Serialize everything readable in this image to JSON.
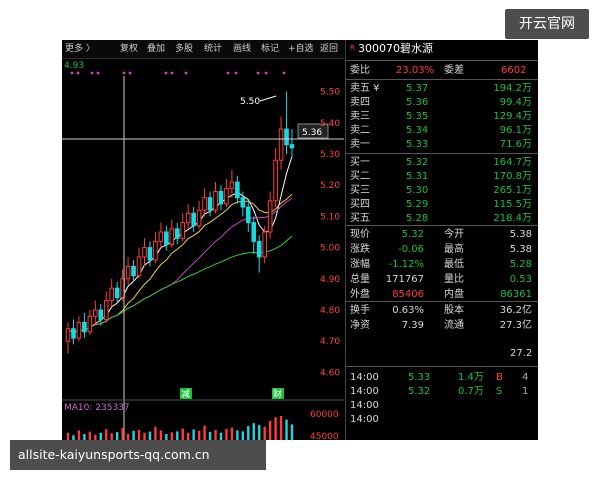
{
  "badge": "开云官网",
  "watermark": "allsite-kaiyunsports-qq.com.cn",
  "toolbar": {
    "more": "更多 〉",
    "fuquan": "复权",
    "diejia": "叠加",
    "duogu": "多股",
    "tongji": "统计",
    "huaxian": "画线",
    "biaoji": "标记",
    "zixuan": "+自选",
    "fanhui": "返回"
  },
  "chart": {
    "left_value": "4.93",
    "price_ticks": [
      "5.50",
      "5.40",
      "5.30",
      "5.20",
      "5.10",
      "5.00",
      "4.90",
      "4.80",
      "4.70",
      "4.60"
    ],
    "peak_label": "5.50",
    "cursor_price": "5.36",
    "marker_jian": "减",
    "marker_cai": "财",
    "ma_label": "MA10: 235337",
    "vol_ticks": [
      "60000",
      "45000"
    ]
  },
  "chart_data": {
    "type": "candlestick",
    "price_axis": {
      "min": 4.55,
      "max": 5.55
    },
    "candles": [
      [
        4.7,
        4.74,
        4.66,
        4.76
      ],
      [
        4.74,
        4.71,
        4.69,
        4.77
      ],
      [
        4.71,
        4.76,
        4.7,
        4.78
      ],
      [
        4.76,
        4.73,
        4.71,
        4.79
      ],
      [
        4.73,
        4.78,
        4.72,
        4.8
      ],
      [
        4.78,
        4.8,
        4.75,
        4.83
      ],
      [
        4.8,
        4.77,
        4.75,
        4.82
      ],
      [
        4.77,
        4.83,
        4.76,
        4.86
      ],
      [
        4.83,
        4.87,
        4.81,
        4.9
      ],
      [
        4.87,
        4.84,
        4.82,
        4.89
      ],
      [
        4.84,
        4.9,
        4.83,
        4.93
      ],
      [
        4.9,
        4.94,
        4.88,
        4.97
      ],
      [
        4.94,
        4.91,
        4.89,
        4.96
      ],
      [
        4.91,
        4.97,
        4.9,
        5.0
      ],
      [
        4.97,
        5.0,
        4.94,
        5.03
      ],
      [
        5.0,
        4.96,
        4.94,
        5.02
      ],
      [
        4.96,
        5.02,
        4.95,
        5.05
      ],
      [
        5.02,
        5.05,
        5.0,
        5.08
      ],
      [
        5.05,
        5.01,
        4.99,
        5.07
      ],
      [
        5.01,
        5.06,
        5.0,
        5.09
      ],
      [
        5.06,
        5.03,
        5.01,
        5.08
      ],
      [
        5.03,
        5.08,
        5.02,
        5.11
      ],
      [
        5.08,
        5.11,
        5.06,
        5.14
      ],
      [
        5.11,
        5.07,
        5.05,
        5.13
      ],
      [
        5.07,
        5.12,
        5.06,
        5.15
      ],
      [
        5.12,
        5.16,
        5.1,
        5.19
      ],
      [
        5.16,
        5.12,
        5.1,
        5.18
      ],
      [
        5.12,
        5.18,
        5.11,
        5.21
      ],
      [
        5.18,
        5.14,
        5.12,
        5.2
      ],
      [
        5.14,
        5.19,
        5.13,
        5.22
      ],
      [
        5.19,
        5.21,
        5.16,
        5.25
      ],
      [
        5.21,
        5.16,
        5.14,
        5.23
      ],
      [
        5.16,
        5.13,
        5.1,
        5.18
      ],
      [
        5.13,
        5.08,
        5.05,
        5.15
      ],
      [
        5.08,
        5.02,
        4.98,
        5.1
      ],
      [
        5.02,
        4.97,
        4.92,
        5.04
      ],
      [
        4.97,
        5.05,
        4.95,
        5.07
      ],
      [
        5.05,
        5.15,
        5.03,
        5.18
      ],
      [
        5.15,
        5.28,
        5.13,
        5.32
      ],
      [
        5.28,
        5.38,
        5.25,
        5.42
      ],
      [
        5.38,
        5.33,
        5.3,
        5.5
      ],
      [
        5.33,
        5.32,
        5.29,
        5.38
      ]
    ],
    "volumes": [
      0.3,
      0.2,
      0.4,
      0.25,
      0.35,
      0.22,
      0.3,
      0.45,
      0.28,
      0.33,
      0.5,
      0.26,
      0.38,
      0.42,
      0.3,
      0.35,
      0.55,
      0.4,
      0.25,
      0.32,
      0.36,
      0.48,
      0.3,
      0.44,
      0.38,
      0.6,
      0.34,
      0.42,
      0.3,
      0.46,
      0.52,
      0.4,
      0.36,
      0.58,
      0.7,
      0.62,
      0.55,
      0.8,
      0.95,
      1.0,
      0.85,
      0.65
    ]
  },
  "quote": {
    "code": "300070",
    "name": "碧水源",
    "weibi_label": "委比",
    "weibi": "23.03%",
    "weicha_label": "委差",
    "weicha": "6602",
    "asks": [
      {
        "label": "卖五 ¥",
        "price": "5.37",
        "vol": "194.2万"
      },
      {
        "label": "卖四",
        "price": "5.36",
        "vol": "99.4万"
      },
      {
        "label": "卖三",
        "price": "5.35",
        "vol": "129.4万"
      },
      {
        "label": "卖二",
        "price": "5.34",
        "vol": "96.1万"
      },
      {
        "label": "卖一",
        "price": "5.33",
        "vol": "71.6万"
      }
    ],
    "bids": [
      {
        "label": "买一",
        "price": "5.32",
        "vol": "164.7万"
      },
      {
        "label": "买二",
        "price": "5.31",
        "vol": "170.8万"
      },
      {
        "label": "买三",
        "price": "5.30",
        "vol": "265.1万"
      },
      {
        "label": "买四",
        "price": "5.29",
        "vol": "115.5万"
      },
      {
        "label": "买五",
        "price": "5.28",
        "vol": "218.4万"
      }
    ],
    "stats": [
      {
        "l1": "现价",
        "v1": "5.32",
        "c1": "green",
        "l2": "今开",
        "v2": "5.38",
        "c2": "white"
      },
      {
        "l1": "涨跌",
        "v1": "-0.06",
        "c1": "green",
        "l2": "最高",
        "v2": "5.38",
        "c2": "white"
      },
      {
        "l1": "涨幅",
        "v1": "-1.12%",
        "c1": "green",
        "l2": "最低",
        "v2": "5.28",
        "c2": "green"
      },
      {
        "l1": "总量",
        "v1": "171767",
        "c1": "white",
        "l2": "量比",
        "v2": "0.53",
        "c2": "green"
      },
      {
        "l1": "外盘",
        "v1": "85406",
        "c1": "red",
        "l2": "内盘",
        "v2": "86361",
        "c2": "green"
      }
    ],
    "fin": [
      {
        "l1": "换手",
        "v1": "0.63%",
        "l2": "股本",
        "v2": "36.2亿"
      },
      {
        "l1": "净资",
        "v1": "7.39",
        "l2": "流通",
        "v2": "27.3亿"
      }
    ],
    "extra_value": "27.2",
    "ticks": [
      {
        "time": "14:00",
        "price": "5.33",
        "vol": "1.4万",
        "side": "B",
        "n": "4"
      },
      {
        "time": "14:00",
        "price": "5.32",
        "vol": "0.7万",
        "side": "S",
        "n": "1"
      },
      {
        "time": "14:00",
        "price": "",
        "vol": "",
        "side": "",
        "n": ""
      },
      {
        "time": "14:00",
        "price": "",
        "vol": "",
        "side": "",
        "n": ""
      }
    ]
  }
}
